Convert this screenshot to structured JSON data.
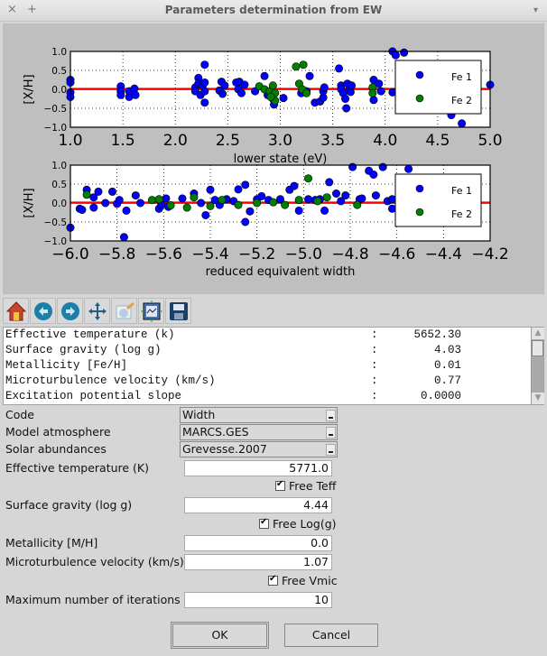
{
  "window": {
    "title": "Parameters determination from EW",
    "close_label": "×",
    "add_label": "+",
    "menu_label": "▾"
  },
  "toolbar": {
    "tools": [
      {
        "name": "home-icon",
        "label": "Home"
      },
      {
        "name": "back-icon",
        "label": "Back"
      },
      {
        "name": "forward-icon",
        "label": "Forward"
      },
      {
        "name": "pan-icon",
        "label": "Pan"
      },
      {
        "name": "zoom-rect-icon",
        "label": "Zoom"
      },
      {
        "name": "subplots-icon",
        "label": "Configure subplots"
      },
      {
        "name": "save-icon",
        "label": "Save"
      }
    ]
  },
  "results": {
    "rows": [
      {
        "label": "Effective temperature (k)",
        "colon": ":",
        "value": "5652.30"
      },
      {
        "label": "Surface gravity (log g)",
        "colon": ":",
        "value": "4.03"
      },
      {
        "label": "Metallicity [Fe/H]",
        "colon": ":",
        "value": "0.01"
      },
      {
        "label": "Microturbulence velocity (km/s)",
        "colon": ":",
        "value": "0.77"
      },
      {
        "label": "Excitation potential slope",
        "colon": ":",
        "value": "0.0000"
      }
    ]
  },
  "form": {
    "code_label": "Code",
    "code_value": "Width",
    "model_label": "Model atmosphere",
    "model_value": "MARCS.GES",
    "solar_label": "Solar abundances",
    "solar_value": "Grevesse.2007",
    "teff_label": "Effective temperature (K)",
    "teff_value": "5771.0",
    "free_teff_label": "Free Teff",
    "free_teff_checked": true,
    "logg_label": "Surface gravity (log g)",
    "logg_value": "4.44",
    "free_logg_label": "Free Log(g)",
    "free_logg_checked": true,
    "mh_label": "Metallicity [M/H]",
    "mh_value": "0.0",
    "vmic_label": "Microturbulence velocity (km/s)",
    "vmic_value": "1.07",
    "free_vmic_label": "Free Vmic",
    "free_vmic_checked": true,
    "iter_label": "Maximum number of iterations",
    "iter_value": "10"
  },
  "buttons": {
    "ok": "OK",
    "cancel": "Cancel"
  },
  "colors": {
    "fe1": "#0000ff",
    "fe2": "#007f00",
    "fit": "#ff0000"
  },
  "chart_data": [
    {
      "type": "scatter",
      "xlabel": "lower state (eV)",
      "ylabel": "[X/H]",
      "xlim": [
        1.0,
        5.0
      ],
      "ylim": [
        -1.0,
        1.0
      ],
      "xticks": [
        "1.0",
        "1.5",
        "2.0",
        "2.5",
        "3.0",
        "3.5",
        "4.0",
        "4.5",
        "5.0"
      ],
      "yticks": [
        "1.0",
        "0.5",
        "0.0",
        "−0.5",
        "−1.0"
      ],
      "grid": true,
      "legend": {
        "placement": "right",
        "entries": [
          "Fe 1",
          "Fe 2"
        ]
      },
      "fit_line": {
        "slope": 0.0,
        "intercept": 0.01
      },
      "series": [
        {
          "name": "Fe 1",
          "points": [
            [
              1.0,
              0.25
            ],
            [
              1.0,
              0.18
            ],
            [
              1.0,
              -0.08
            ],
            [
              1.0,
              -0.2
            ],
            [
              1.48,
              0.08
            ],
            [
              1.48,
              -0.05
            ],
            [
              1.48,
              -0.15
            ],
            [
              1.56,
              -0.2
            ],
            [
              1.56,
              -0.05
            ],
            [
              1.61,
              0.02
            ],
            [
              1.62,
              -0.15
            ],
            [
              2.19,
              0.05
            ],
            [
              2.19,
              -0.05
            ],
            [
              2.22,
              0.3
            ],
            [
              2.22,
              0.15
            ],
            [
              2.24,
              -0.15
            ],
            [
              2.26,
              0.1
            ],
            [
              2.28,
              0.65
            ],
            [
              2.28,
              0.18
            ],
            [
              2.28,
              -0.05
            ],
            [
              2.28,
              -0.35
            ],
            [
              2.42,
              -0.03
            ],
            [
              2.44,
              0.2
            ],
            [
              2.45,
              -0.12
            ],
            [
              2.47,
              0.1
            ],
            [
              2.58,
              0.18
            ],
            [
              2.6,
              0.0
            ],
            [
              2.61,
              0.2
            ],
            [
              2.63,
              -0.1
            ],
            [
              2.66,
              0.12
            ],
            [
              2.76,
              -0.05
            ],
            [
              2.85,
              0.35
            ],
            [
              2.88,
              -0.15
            ],
            [
              2.93,
              -0.25
            ],
            [
              2.94,
              -0.4
            ],
            [
              3.03,
              -0.23
            ],
            [
              3.2,
              -0.1
            ],
            [
              3.25,
              -0.05
            ],
            [
              3.28,
              0.35
            ],
            [
              3.33,
              -0.35
            ],
            [
              3.38,
              -0.32
            ],
            [
              3.41,
              -0.22
            ],
            [
              3.41,
              -0.05
            ],
            [
              3.42,
              0.05
            ],
            [
              3.56,
              0.55
            ],
            [
              3.58,
              0.1
            ],
            [
              3.58,
              0.0
            ],
            [
              3.6,
              -0.1
            ],
            [
              3.62,
              -0.25
            ],
            [
              3.64,
              0.15
            ],
            [
              3.66,
              0.0
            ],
            [
              3.67,
              -0.07
            ],
            [
              3.68,
              0.1
            ],
            [
              3.63,
              -0.5
            ],
            [
              3.89,
              0.25
            ],
            [
              3.89,
              -0.28
            ],
            [
              3.94,
              0.15
            ],
            [
              3.96,
              -0.05
            ],
            [
              4.07,
              -0.08
            ],
            [
              4.07,
              1.0
            ],
            [
              4.1,
              0.9
            ],
            [
              4.18,
              0.97
            ],
            [
              4.63,
              -0.68
            ],
            [
              4.73,
              -0.9
            ],
            [
              5.0,
              0.12
            ]
          ]
        },
        {
          "name": "Fe 2",
          "points": [
            [
              2.8,
              0.08
            ],
            [
              2.85,
              0.0
            ],
            [
              2.9,
              -0.05
            ],
            [
              2.93,
              0.1
            ],
            [
              2.95,
              -0.1
            ],
            [
              2.95,
              -0.3
            ],
            [
              2.91,
              -0.2
            ],
            [
              3.15,
              0.6
            ],
            [
              3.22,
              0.65
            ],
            [
              3.18,
              0.15
            ],
            [
              3.21,
              0.0
            ],
            [
              3.25,
              -0.1
            ],
            [
              3.88,
              0.05
            ],
            [
              3.88,
              -0.1
            ]
          ]
        }
      ]
    },
    {
      "type": "scatter",
      "xlabel": "reduced equivalent width",
      "ylabel": "[X/H]",
      "xlim": [
        -6.0,
        -4.2
      ],
      "ylim": [
        -1.0,
        1.0
      ],
      "xticks": [
        "−6.0",
        "−5.8",
        "−5.6",
        "−5.4",
        "−5.2",
        "−5.0",
        "−4.8",
        "−4.6",
        "−4.4",
        "−4.2"
      ],
      "yticks": [
        "1.0",
        "0.5",
        "0.0",
        "−0.5",
        "−1.0"
      ],
      "grid": true,
      "legend": {
        "placement": "right",
        "entries": [
          "Fe 1",
          "Fe 2"
        ]
      },
      "fit_line": {
        "slope": 0.0,
        "intercept": 0.01
      },
      "series": [
        {
          "name": "Fe 1",
          "points": [
            [
              -6.0,
              -0.65
            ],
            [
              -5.96,
              -0.15
            ],
            [
              -5.95,
              -0.18
            ],
            [
              -5.93,
              0.35
            ],
            [
              -5.9,
              0.15
            ],
            [
              -5.9,
              -0.12
            ],
            [
              -5.88,
              0.3
            ],
            [
              -5.85,
              0.0
            ],
            [
              -5.82,
              0.3
            ],
            [
              -5.8,
              -0.02
            ],
            [
              -5.79,
              0.08
            ],
            [
              -5.77,
              -0.9
            ],
            [
              -5.76,
              -0.2
            ],
            [
              -5.72,
              0.2
            ],
            [
              -5.7,
              0.0
            ],
            [
              -5.62,
              -0.15
            ],
            [
              -5.61,
              -0.05
            ],
            [
              -5.59,
              0.12
            ],
            [
              -5.58,
              -0.1
            ],
            [
              -5.52,
              0.12
            ],
            [
              -5.47,
              0.25
            ],
            [
              -5.44,
              0.0
            ],
            [
              -5.42,
              -0.32
            ],
            [
              -5.4,
              0.35
            ],
            [
              -5.38,
              0.08
            ],
            [
              -5.36,
              -0.05
            ],
            [
              -5.33,
              0.1
            ],
            [
              -5.3,
              0.05
            ],
            [
              -5.28,
              0.36
            ],
            [
              -5.25,
              0.48
            ],
            [
              -5.25,
              -0.5
            ],
            [
              -5.23,
              -0.22
            ],
            [
              -5.2,
              0.1
            ],
            [
              -5.18,
              0.18
            ],
            [
              -5.15,
              0.08
            ],
            [
              -5.1,
              0.1
            ],
            [
              -5.06,
              0.35
            ],
            [
              -5.04,
              0.45
            ],
            [
              -5.02,
              -0.2
            ],
            [
              -4.98,
              0.1
            ],
            [
              -4.95,
              0.08
            ],
            [
              -4.93,
              0.1
            ],
            [
              -4.91,
              -0.2
            ],
            [
              -4.89,
              0.55
            ],
            [
              -4.86,
              0.25
            ],
            [
              -4.84,
              0.05
            ],
            [
              -4.82,
              0.2
            ],
            [
              -4.79,
              0.95
            ],
            [
              -4.76,
              0.1
            ],
            [
              -4.72,
              0.85
            ],
            [
              -4.7,
              0.75
            ],
            [
              -4.66,
              0.95
            ],
            [
              -4.64,
              0.05
            ],
            [
              -4.62,
              -0.15
            ],
            [
              -4.62,
              0.1
            ],
            [
              -4.75,
              0.12
            ],
            [
              -4.69,
              0.2
            ],
            [
              -4.55,
              0.9
            ]
          ]
        },
        {
          "name": "Fe 2",
          "points": [
            [
              -5.93,
              0.22
            ],
            [
              -5.65,
              0.08
            ],
            [
              -5.62,
              0.1
            ],
            [
              -5.57,
              -0.06
            ],
            [
              -5.5,
              -0.12
            ],
            [
              -5.47,
              0.15
            ],
            [
              -5.4,
              -0.08
            ],
            [
              -5.35,
              0.08
            ],
            [
              -5.28,
              -0.05
            ],
            [
              -5.2,
              0.0
            ],
            [
              -5.13,
              0.02
            ],
            [
              -5.08,
              -0.05
            ],
            [
              -5.02,
              0.08
            ],
            [
              -4.98,
              0.65
            ],
            [
              -4.94,
              0.05
            ],
            [
              -4.9,
              0.15
            ],
            [
              -4.77,
              -0.05
            ]
          ]
        }
      ]
    }
  ]
}
